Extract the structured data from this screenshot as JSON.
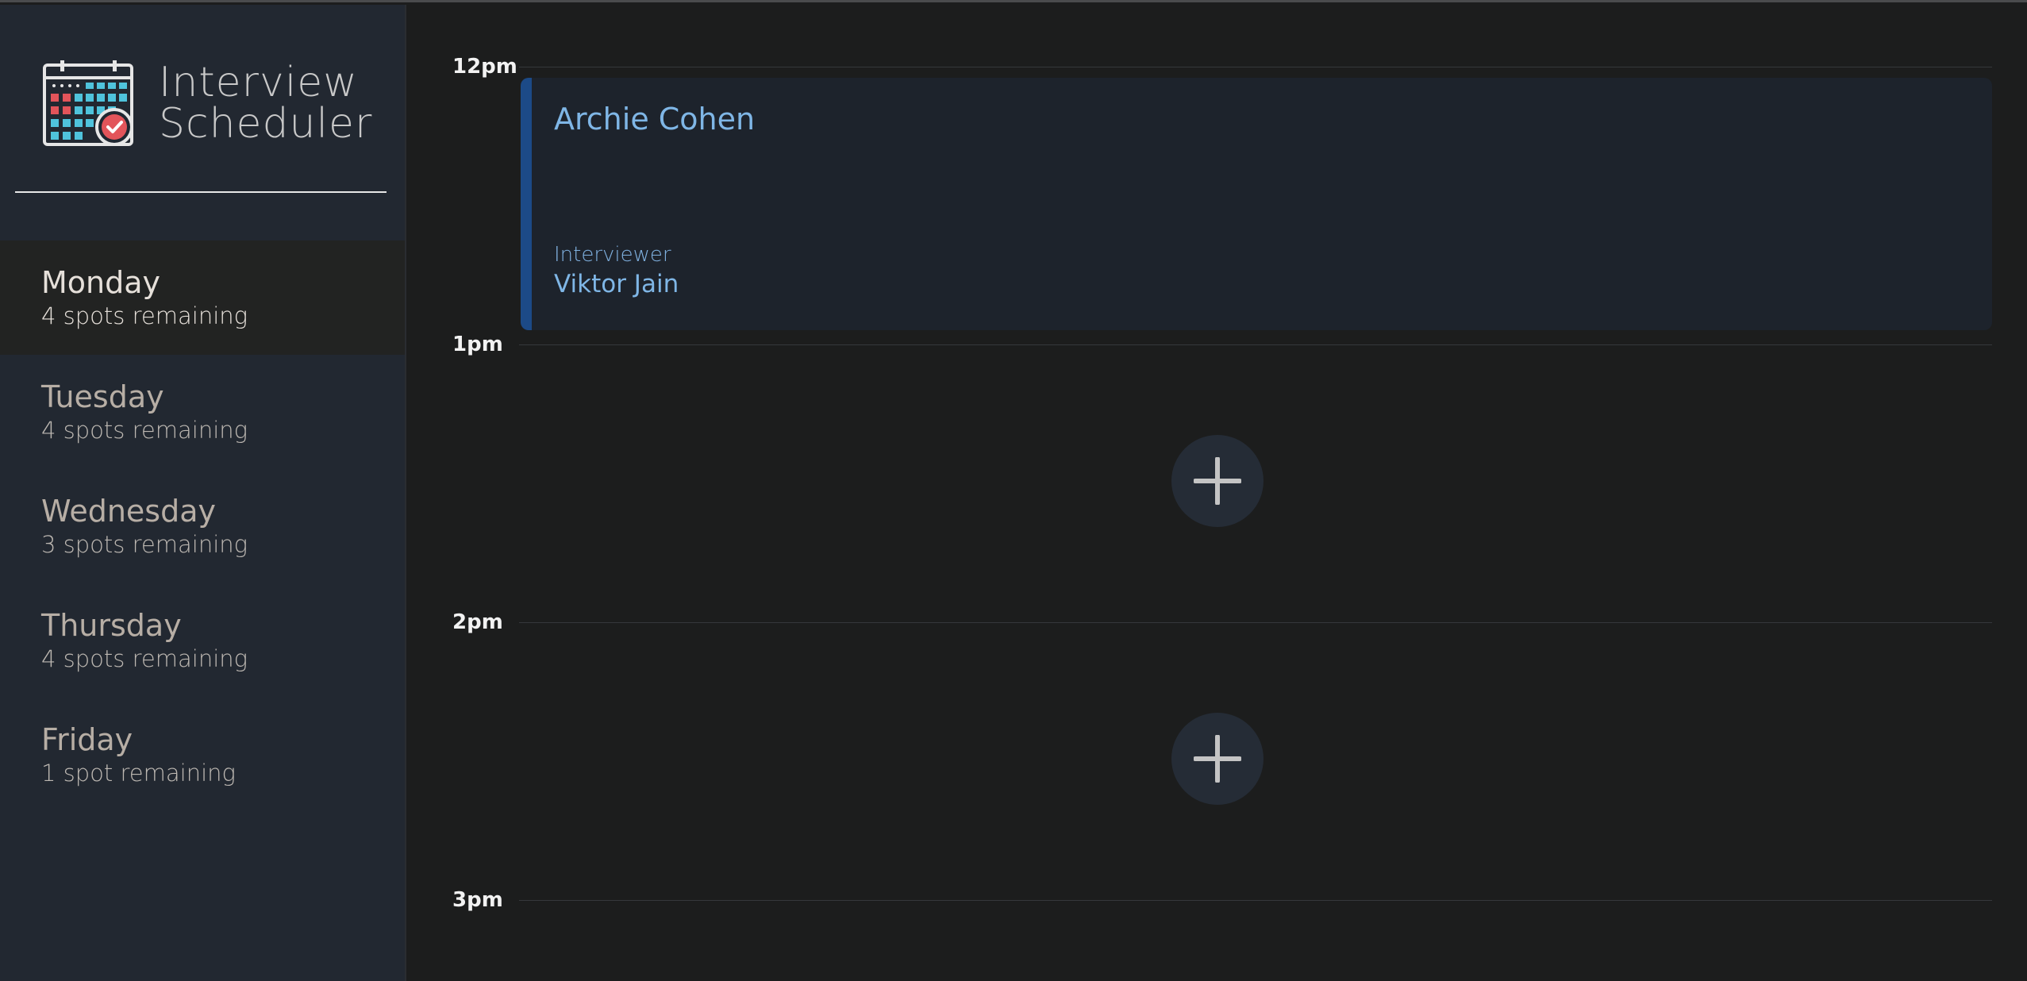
{
  "brand": {
    "title_line1": "Interview",
    "title_line2": "Scheduler",
    "logo_icon": "calendar-check-icon"
  },
  "days": [
    {
      "name": "Monday",
      "spots": "4 spots remaining",
      "selected": true
    },
    {
      "name": "Tuesday",
      "spots": "4 spots remaining",
      "selected": false
    },
    {
      "name": "Wednesday",
      "spots": "3 spots remaining",
      "selected": false
    },
    {
      "name": "Thursday",
      "spots": "4 spots remaining",
      "selected": false
    },
    {
      "name": "Friday",
      "spots": "1 spot remaining",
      "selected": false
    }
  ],
  "schedule": {
    "hours": [
      "12pm",
      "1pm",
      "2pm",
      "3pm"
    ],
    "appointment": {
      "student": "Archie Cohen",
      "interviewer_label": "Interviewer",
      "interviewer": "Viktor Jain"
    },
    "add_icon": "plus-icon"
  },
  "colors": {
    "sidebar_bg": "#222831",
    "main_bg": "#1c1d1d",
    "accent_blue": "#7fb6e6",
    "appointment_border": "#1c4a87",
    "logo_red": "#e2545a",
    "logo_cyan": "#4fc3dc"
  }
}
